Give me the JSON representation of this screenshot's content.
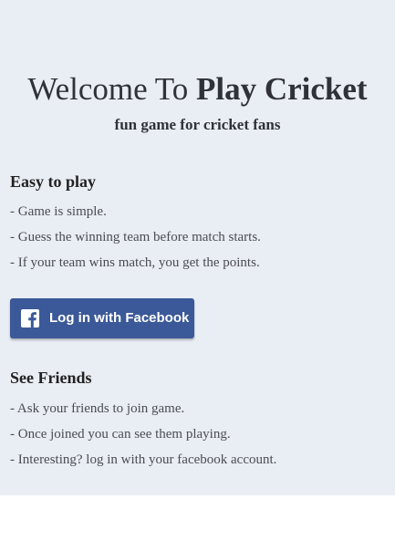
{
  "header": {
    "title_prefix": "Welcome To ",
    "title_brand": "Play Cricket",
    "subtitle": "fun game for cricket fans"
  },
  "section_easy": {
    "heading": "Easy to play",
    "items": [
      "- Game is simple.",
      "- Guess the winning team before match starts.",
      "- If your team wins match, you get the points."
    ]
  },
  "login": {
    "label": "Log in with Facebook",
    "icon": "facebook-icon",
    "color": "#3b5998"
  },
  "section_friends": {
    "heading": "See Friends",
    "items": [
      "- Ask your friends to join game.",
      "- Once joined you can see them playing.",
      "- Interesting? log in with your facebook account."
    ]
  },
  "colors": {
    "panel_background": "#e9edf4",
    "page_background": "#ffffff"
  }
}
